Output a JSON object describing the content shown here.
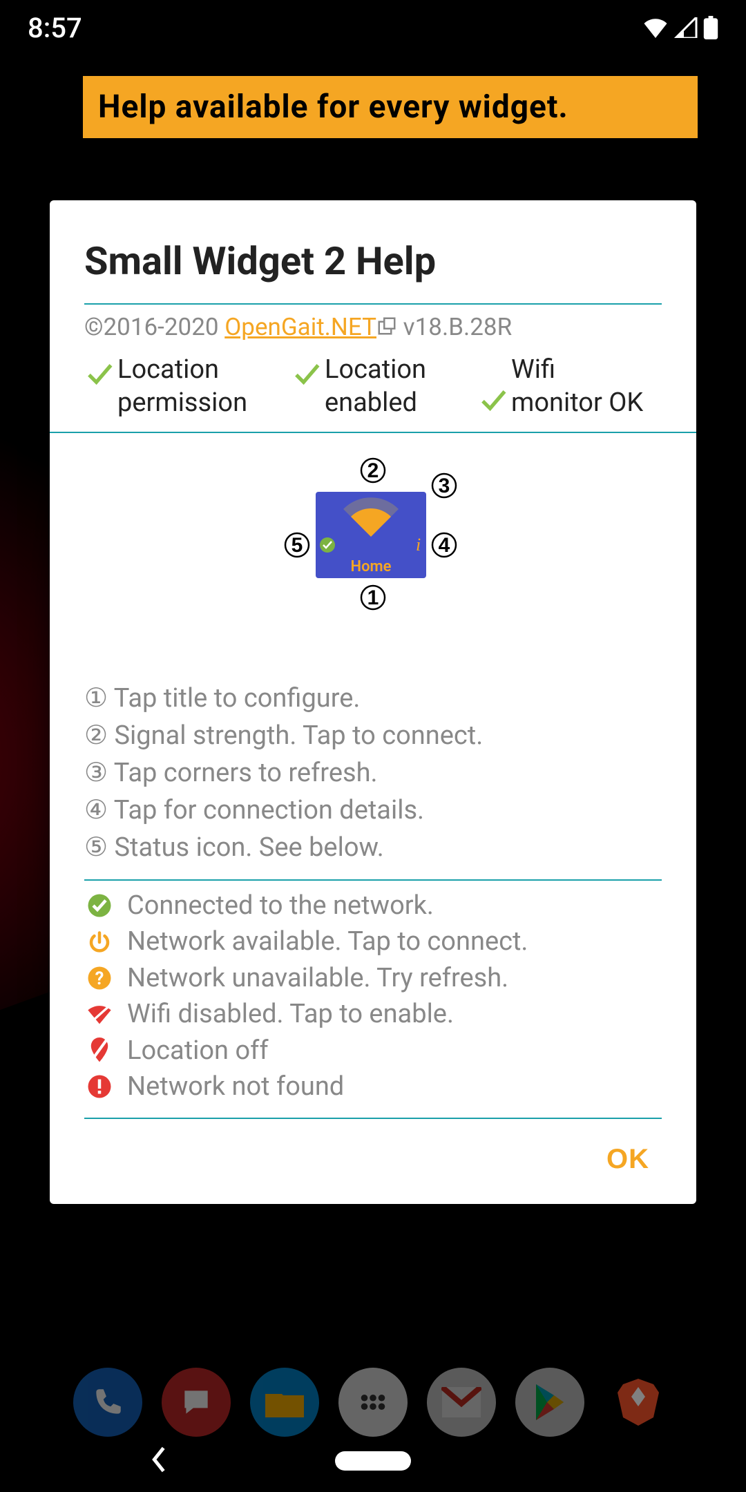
{
  "status_bar": {
    "time": "8:57"
  },
  "banner": "Help available for every widget.",
  "dialog": {
    "title": "Small Widget 2 Help",
    "copyright_prefix": "©2016-2020 ",
    "copyright_link": "OpenGait.NET",
    "version": " v18.B.28R",
    "status_items": [
      {
        "label": "Location permission"
      },
      {
        "label": "Location enabled"
      },
      {
        "label": "Wifi monitor OK"
      }
    ],
    "diagram": {
      "home_label": "Home"
    },
    "help_lines": [
      "① Tap title to configure.",
      "② Signal strength. Tap to connect.",
      "③ Tap corners to refresh.",
      "④ Tap for connection details.",
      "⑤ Status icon. See below."
    ],
    "status_legend": [
      {
        "icon": "check-circle",
        "text": "Connected to the network."
      },
      {
        "icon": "power",
        "text": "Network available. Tap to connect."
      },
      {
        "icon": "question-circle",
        "text": "Network unavailable. Try refresh."
      },
      {
        "icon": "wifi-off",
        "text": "Wifi disabled. Tap to enable."
      },
      {
        "icon": "location-off",
        "text": "Location off"
      },
      {
        "icon": "error-circle",
        "text": "Network not found"
      }
    ],
    "ok": "OK"
  },
  "dock": {
    "items": [
      "phone",
      "messages",
      "files",
      "app-drawer",
      "gmail",
      "play-store",
      "brave"
    ]
  }
}
